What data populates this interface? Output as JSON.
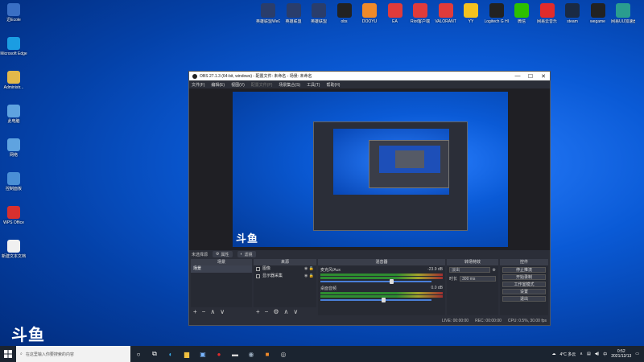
{
  "desktop": {
    "left_icons": [
      {
        "label": "迅Ecole",
        "icon": "app-icon",
        "color": "#3a6fc4"
      },
      {
        "label": "Microsoft Edge",
        "icon": "edge-icon",
        "color": "#1b9de2"
      },
      {
        "label": "Administr...",
        "icon": "user-folder-icon",
        "color": "#e2b84a"
      },
      {
        "label": "此电脑",
        "icon": "computer-icon",
        "color": "#5fa3e0"
      },
      {
        "label": "网络",
        "icon": "network-icon",
        "color": "#5fa3e0"
      },
      {
        "label": "控制面板",
        "icon": "control-panel-icon",
        "color": "#4a8fd6"
      },
      {
        "label": "WPS Office",
        "icon": "wps-icon",
        "color": "#d8302f"
      },
      {
        "label": "新建文本文档",
        "icon": "text-file-icon",
        "color": "#f0f0f0"
      }
    ],
    "top_icons": [
      {
        "label": "英雄联盟WeGa",
        "icon": "lol-icon",
        "color": "#2a3d6b"
      },
      {
        "label": "英雄联盟",
        "icon": "lol-icon",
        "color": "#2a3d6b"
      },
      {
        "label": "英雄联盟",
        "icon": "lol-icon",
        "color": "#2a3d6b"
      },
      {
        "label": "obs",
        "icon": "obs-icon",
        "color": "#222"
      },
      {
        "label": "DOOYU",
        "icon": "douyu-icon",
        "color": "#f08a2a"
      },
      {
        "label": "EA",
        "icon": "ea-icon",
        "color": "#e03b3b"
      },
      {
        "label": "Riot客户端",
        "icon": "riot-icon",
        "color": "#e03b3b"
      },
      {
        "label": "VALORANT",
        "icon": "valorant-icon",
        "color": "#e03b3b"
      },
      {
        "label": "YY",
        "icon": "yy-icon",
        "color": "#f4c21f"
      },
      {
        "label": "Logitech G HUB",
        "icon": "logitech-icon",
        "color": "#222"
      },
      {
        "label": "微信",
        "icon": "wechat-icon",
        "color": "#2dc100"
      },
      {
        "label": "网易云音乐",
        "icon": "netease-music-icon",
        "color": "#e02b2b"
      },
      {
        "label": "steam",
        "icon": "steam-icon",
        "color": "#1a2a44"
      },
      {
        "label": "wegame",
        "icon": "wegame-icon",
        "color": "#222"
      },
      {
        "label": "网易UU加速器",
        "icon": "uu-icon",
        "color": "#2a9d8f"
      }
    ],
    "watermark": "斗鱼",
    "background_color": "#0a5ad6"
  },
  "obs": {
    "title": "OBS 27.1.3 (64-bit, windows) - 配置文件: 未命名 - 场景: 未命名",
    "menu": [
      "文件(F)",
      "编辑(E)",
      "视图(V)",
      "配置文件(P)",
      "场景集合(S)",
      "工具(T)",
      "帮助(H)"
    ],
    "status_strip": {
      "label": "未选择源",
      "props": "属性",
      "filters": "滤镜"
    },
    "scenes": {
      "header": "场景",
      "items": [
        "场景"
      ]
    },
    "sources": {
      "header": "来源",
      "items": [
        "图像",
        "显示器采集"
      ]
    },
    "mixer": {
      "header": "混音器",
      "tracks": [
        {
          "name": "麦克风/Aux",
          "db": "-23.9 dB",
          "level": 0.62
        },
        {
          "name": "桌面音频",
          "db": "0.0 dB",
          "level": 0.55
        }
      ]
    },
    "transitions": {
      "header": "转场特效",
      "type": "淡出",
      "duration_label": "时长",
      "duration": "300 ms"
    },
    "controls": {
      "header": "控件",
      "buttons": [
        "停止推流",
        "开始录制",
        "工作室模式",
        "设置",
        "退出"
      ]
    },
    "statusbar": {
      "live": "LIVE: 00:00:00",
      "rec": "REC: 00:00:00",
      "cpu": "CPU: 0.5%, 30.00 fps"
    },
    "window_buttons": {
      "minimize": "—",
      "maximize": "☐",
      "close": "✕"
    }
  },
  "taskbar": {
    "search_placeholder": "在这里输入你要搜索的内容",
    "weather": "4°C  多云",
    "time": "0:52",
    "date": "2021/12/13",
    "colors": {
      "bg": "#1b2430"
    }
  }
}
